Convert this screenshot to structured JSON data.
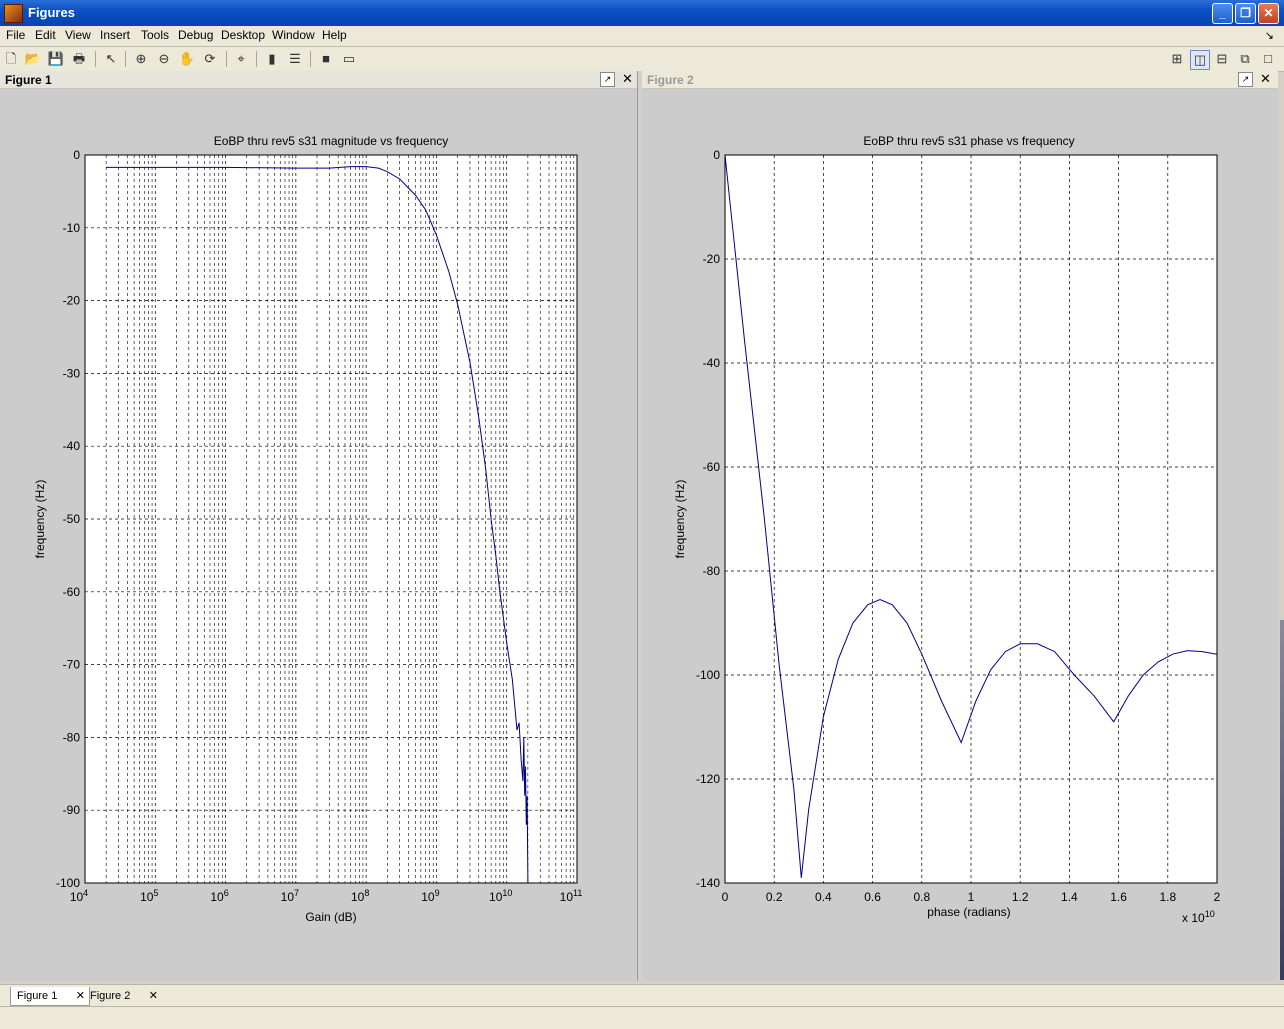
{
  "window": {
    "title": "Figures"
  },
  "menu": [
    "File",
    "Edit",
    "View",
    "Insert",
    "Tools",
    "Debug",
    "Desktop",
    "Window",
    "Help"
  ],
  "toolbar_icons": [
    "new-file-icon",
    "open-folder-icon",
    "save-icon",
    "print-icon",
    "pointer-icon",
    "zoom-in-icon",
    "zoom-out-icon",
    "pan-hand-icon",
    "rotate-3d-icon",
    "data-cursor-icon",
    "colorbar-icon",
    "legend-icon",
    "hide-plot-tools-icon",
    "show-plot-tools-icon"
  ],
  "layout_icons": [
    "tile-icon",
    "split-vertical-icon",
    "split-horizontal-icon",
    "float-icon",
    "maximize-icon"
  ],
  "panels": {
    "figure1": {
      "title": "Figure 1"
    },
    "figure2": {
      "title": "Figure 2"
    }
  },
  "tabs": [
    {
      "label": "Figure 1",
      "active": true
    },
    {
      "label": "Figure 2",
      "active": false
    }
  ],
  "colors": {
    "line": "#00008b",
    "axes_bg": "#ffffff",
    "figure_bg": "#cccccc"
  },
  "chart_data": [
    {
      "type": "line",
      "title": "EoBP thru rev5 s31 magnitude vs frequency",
      "xlabel": "Gain (dB)",
      "ylabel": "frequency (Hz)",
      "xscale": "log",
      "xlim": [
        10000,
        100000000000
      ],
      "ylim": [
        -100,
        0
      ],
      "xtick_exponents": [
        4,
        5,
        6,
        7,
        8,
        9,
        10,
        11
      ],
      "xtick_base": "10",
      "yticks": [
        0,
        -10,
        -20,
        -30,
        -40,
        -50,
        -60,
        -70,
        -80,
        -90,
        -100
      ],
      "grid": true,
      "series": [
        {
          "x": [
            20000,
            100000,
            1000000,
            10000000,
            30000000,
            60000000,
            100000000,
            150000000,
            200000000,
            300000000,
            500000000,
            700000000,
            1000000000,
            1500000000,
            2000000000,
            3000000000,
            4000000000,
            5000000000,
            6000000000,
            7000000000,
            8000000000,
            10000000000,
            12000000000,
            14000000000,
            15000000000,
            16000000000,
            17000000000,
            17500000000,
            18000000000,
            18500000000,
            19000000000,
            19500000000,
            20000000000
          ],
          "y": [
            -1.7,
            -1.7,
            -1.7,
            -1.8,
            -1.8,
            -1.6,
            -1.6,
            -1.8,
            -2.3,
            -3.3,
            -5.5,
            -7.5,
            -11.0,
            -16.0,
            -20.5,
            -28.5,
            -36.0,
            -43.0,
            -50.0,
            -55.0,
            -60.0,
            -67.0,
            -72.0,
            -79.0,
            -78.0,
            -83.0,
            -86.0,
            -80.0,
            -88.0,
            -84.0,
            -92.0,
            -88.0,
            -100.0
          ]
        }
      ]
    },
    {
      "type": "line",
      "title": "EoBP thru rev5 s31 phase vs frequency",
      "xlabel": "phase (radians)",
      "ylabel": "frequency (Hz)",
      "x_multiplier": "x 10",
      "x_multiplier_exp": "10",
      "xlim": [
        0,
        2
      ],
      "ylim": [
        -140,
        0
      ],
      "xticks": [
        "0",
        "0.2",
        "0.4",
        "0.6",
        "0.8",
        "1",
        "1.2",
        "1.4",
        "1.6",
        "1.8",
        "2"
      ],
      "yticks": [
        0,
        -20,
        -40,
        -60,
        -80,
        -100,
        -120,
        -140
      ],
      "grid": true,
      "series": [
        {
          "x": [
            0,
            0.08,
            0.16,
            0.22,
            0.28,
            0.31,
            0.34,
            0.4,
            0.46,
            0.52,
            0.58,
            0.63,
            0.68,
            0.74,
            0.8,
            0.88,
            0.96,
            1.02,
            1.08,
            1.14,
            1.2,
            1.27,
            1.34,
            1.42,
            1.5,
            1.58,
            1.64,
            1.7,
            1.76,
            1.82,
            1.88,
            1.94,
            2.0
          ],
          "y": [
            0,
            -36,
            -70,
            -98,
            -122,
            -139,
            -126,
            -108,
            -97,
            -90,
            -86.5,
            -85.5,
            -86.5,
            -90,
            -96,
            -105,
            -113,
            -105,
            -99,
            -95.5,
            -94,
            -94,
            -95.5,
            -100,
            -104,
            -109,
            -104,
            -100,
            -97.5,
            -96,
            -95.3,
            -95.5,
            -96
          ]
        }
      ]
    }
  ]
}
